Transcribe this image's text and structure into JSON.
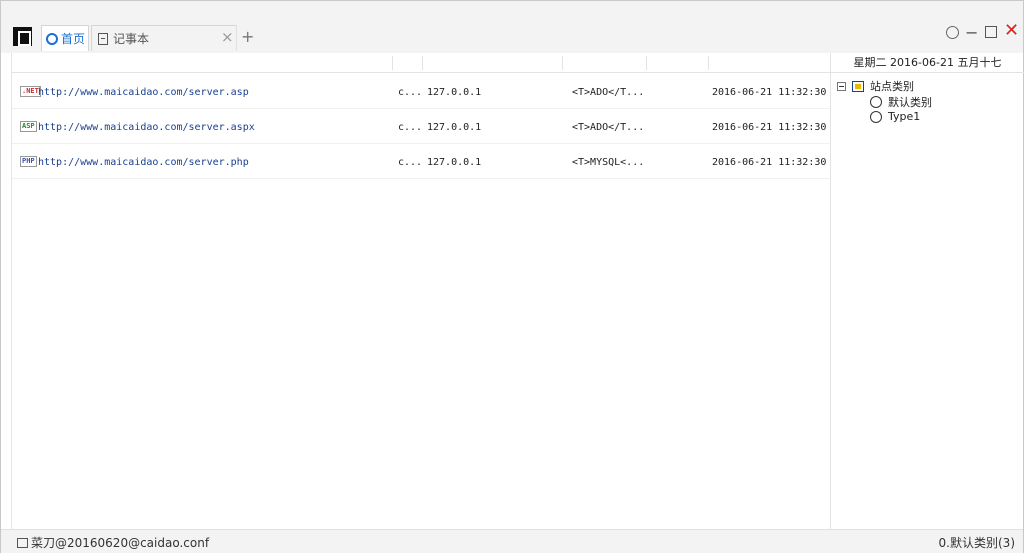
{
  "tabs": [
    {
      "label": "首页",
      "icon": "home-ring-icon",
      "active": true
    },
    {
      "label": "记事本",
      "icon": "document-icon",
      "active": false
    }
  ],
  "tab_controls": {
    "close": "×",
    "add": "+"
  },
  "window_controls": {
    "minimize": "−",
    "close": "✕"
  },
  "sidebar": {
    "date": "星期二 2016-06-21 五月十七",
    "tree": {
      "root_label": "站点类别",
      "children": [
        "默认类别",
        "Type1"
      ]
    }
  },
  "sites": [
    {
      "type": ".NET",
      "url": "http://www.maicaidao.com/server.asp",
      "note": "c...",
      "ip": "127.0.0.1",
      "config": "<T>ADO</T...",
      "time": "2016-06-21 11:32:30"
    },
    {
      "type": "ASP",
      "url": "http://www.maicaidao.com/server.aspx",
      "note": "c...",
      "ip": "127.0.0.1",
      "config": "<T>ADO</T...",
      "time": "2016-06-21 11:32:30"
    },
    {
      "type": "PHP",
      "url": "http://www.maicaidao.com/server.php",
      "note": "c...",
      "ip": "127.0.0.1",
      "config": "<T>MYSQL<...",
      "time": "2016-06-21 11:32:30"
    }
  ],
  "status": {
    "left": "菜刀@20160620@caidao.conf",
    "right": "0.默认类别(3)"
  },
  "colors": {
    "accent": "#1a6fd6",
    "close_red": "#e0221a",
    "url_text": "#1a3f8f"
  }
}
